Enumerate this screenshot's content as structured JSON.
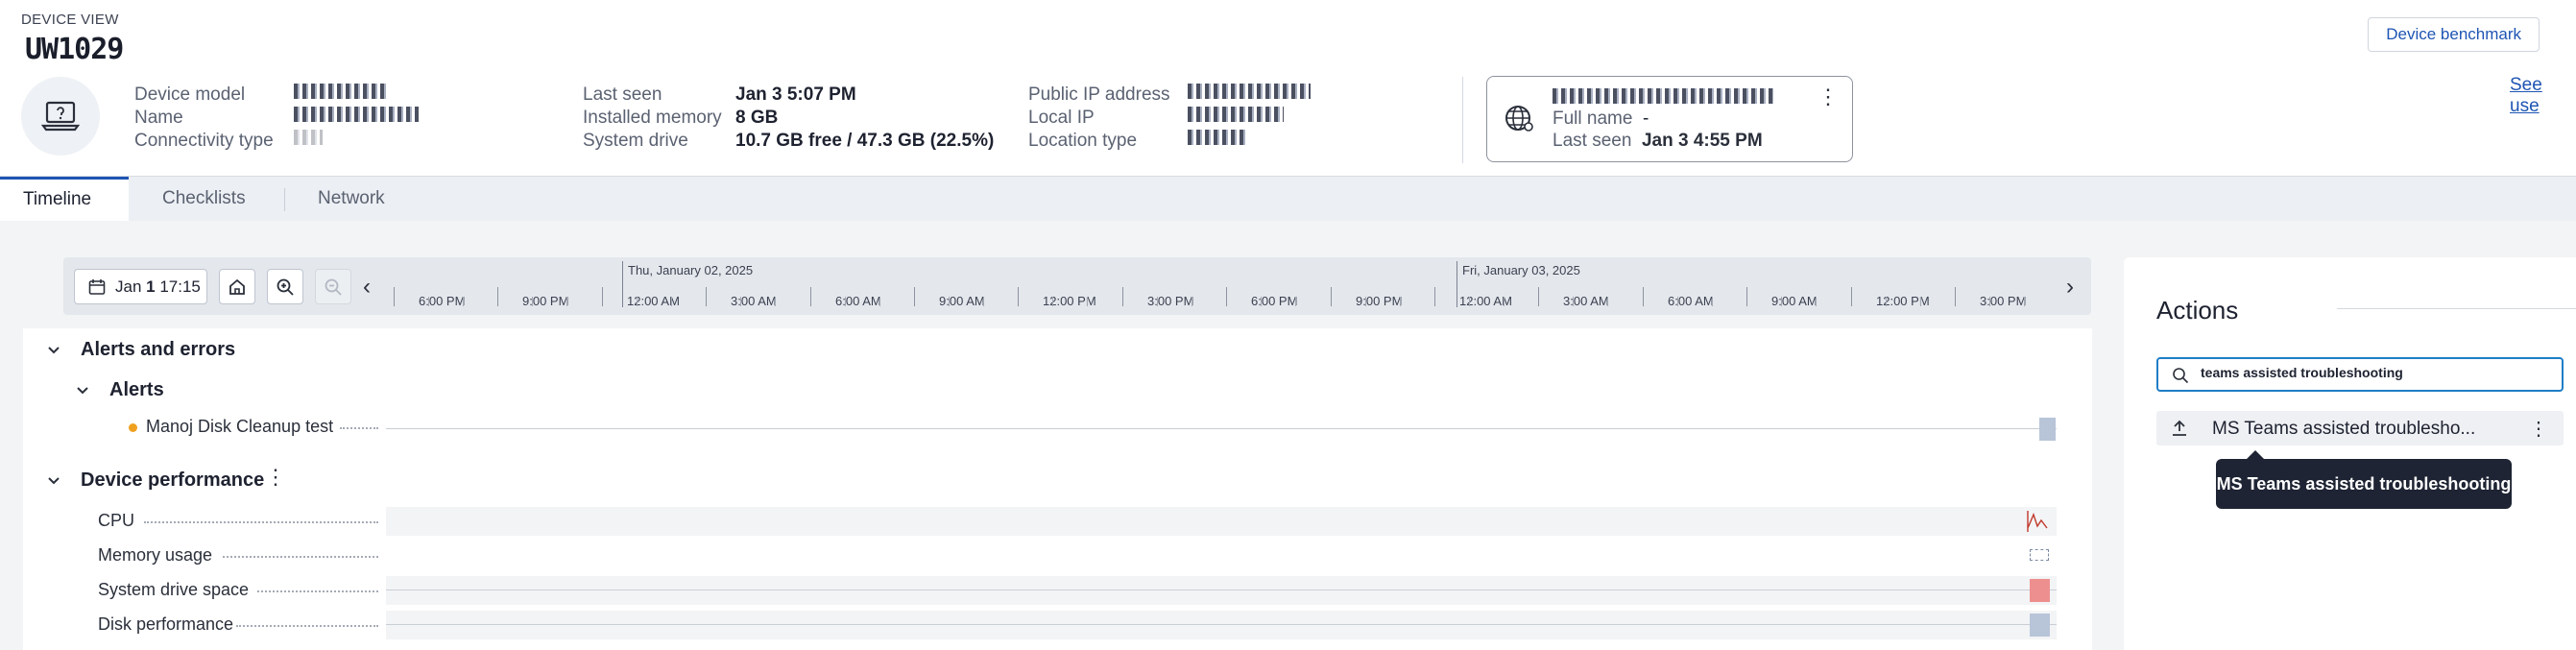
{
  "header": {
    "eyebrow": "DEVICE VIEW",
    "device_id": "UW1029",
    "benchmark_label": "Device benchmark",
    "see_users_label": "See use"
  },
  "device_info": {
    "col1": [
      {
        "label": "Device model",
        "value": ""
      },
      {
        "label": "Name",
        "value": ""
      },
      {
        "label": "Connectivity type",
        "value": ""
      }
    ],
    "col2": [
      {
        "label": "Last seen",
        "value": "Jan 3 5:07 PM"
      },
      {
        "label": "Installed memory",
        "value": "8 GB"
      },
      {
        "label": "System drive",
        "value": "10.7 GB free / 47.3 GB (22.5%)"
      }
    ],
    "col3": [
      {
        "label": "Public IP address",
        "value": ""
      },
      {
        "label": "Local IP",
        "value": ""
      },
      {
        "label": "Location type",
        "value": ""
      }
    ]
  },
  "user_card": {
    "full_name_label": "Full name",
    "full_name_value": "-",
    "last_seen_label": "Last seen",
    "last_seen_value": "Jan 3 4:55 PM",
    "icon": "globe-user-icon"
  },
  "tabs": [
    {
      "label": "Timeline",
      "active": true
    },
    {
      "label": "Checklists",
      "active": false
    },
    {
      "label": "Network",
      "active": false
    }
  ],
  "timeline": {
    "date_button": {
      "prefix": "Jan ",
      "day": "1",
      "time": " 17:15"
    },
    "days": [
      "Thu, January 02, 2025",
      "Fri, January 03, 2025"
    ],
    "hours": [
      "6:00 PM",
      "9:00 PM",
      "12:00 AM",
      "3:00 AM",
      "6:00 AM",
      "9:00 AM",
      "12:00 PM",
      "3:00 PM",
      "6:00 PM",
      "9:00 PM",
      "12:00 AM",
      "3:00 AM",
      "6:00 AM",
      "9:00 AM",
      "12:00 PM",
      "3:00 PM"
    ],
    "groups": {
      "alerts_errors": "Alerts and errors",
      "alerts": "Alerts",
      "alert_item": "Manoj Disk Cleanup test",
      "device_performance": "Device performance",
      "metrics": [
        "CPU",
        "Memory usage",
        "System drive space",
        "Disk performance"
      ]
    }
  },
  "actions": {
    "title": "Actions",
    "search_value": "teams assisted troubleshooting",
    "result_label": "MS Teams assisted troublesho...",
    "tooltip": "MS Teams assisted troubleshooting"
  },
  "colors": {
    "accent": "#1e55b3",
    "search_focus": "#1f7ec7",
    "alert_dot": "#f0a020",
    "drive_bar": "#ee8f8f",
    "disk_bar": "#b8c4d8",
    "cpu_line": "#c0392b"
  }
}
